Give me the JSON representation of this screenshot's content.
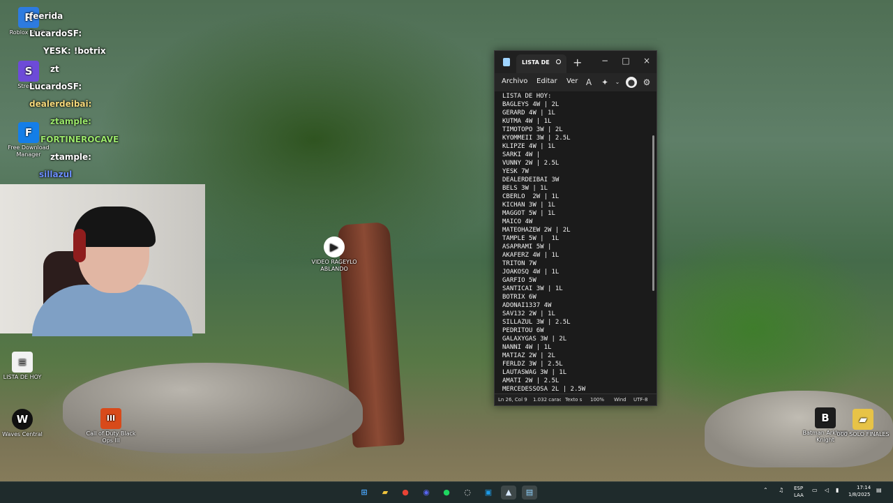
{
  "desktop": {
    "icons": [
      {
        "label": "Roblox Studio",
        "glyph": "R",
        "color": "#2d7be0"
      },
      {
        "label": "Stremio",
        "glyph": "S",
        "color": "#6d4bd8"
      },
      {
        "label": "Free Download Manager",
        "glyph": "F",
        "color": "#147ee8"
      },
      {
        "label": "LISTA DE HOY",
        "glyph": "≡",
        "color": "#f2f2f2"
      },
      {
        "label": "Waves Central",
        "glyph": "W",
        "color": "#111111"
      },
      {
        "label": "Call of Duty Black Ops III",
        "glyph": "III",
        "color": "#d84a1a"
      },
      {
        "label": "Batman Arkham Knight",
        "glyph": "B",
        "color": "#1d1d1d"
      },
      {
        "label": "000 SOLO FINALES",
        "glyph": "▰",
        "color": "#e7c347"
      },
      {
        "label": "VIDEO RAGEYLO ABLANDO",
        "glyph": "▶",
        "color": "#ffffff"
      }
    ]
  },
  "chat": {
    "messages": [
      {
        "user": "feerida",
        "color": "#ffffff"
      },
      {
        "user": "LucardoSF:",
        "color": "#ffffff"
      },
      {
        "user": "YESK:",
        "text": "!botrix",
        "color": "#ffffff"
      },
      {
        "user": "zt",
        "color": "#ffffff"
      },
      {
        "user": "LucardoSF:",
        "color": "#ffffff"
      },
      {
        "user": "dealerdeibai:",
        "color": "#f5d97b"
      },
      {
        "user": "ztample:",
        "color": "#9be86b"
      },
      {
        "user": "FORTINEROCAVE",
        "color": "#9be86b"
      },
      {
        "user": "ztample:",
        "color": "#ffffff"
      },
      {
        "user": "sillazul",
        "color": "#6c8fff"
      }
    ]
  },
  "notepad": {
    "tab_title": "LISTA DE H",
    "new_tab": "+",
    "window_controls": [
      "−",
      "□",
      "×"
    ],
    "menu": {
      "file": "Archivo",
      "edit": "Editar",
      "view": "Ver"
    },
    "text_lines": [
      "LISTA DE HOY:",
      "BAGLEYS 4W | 2L",
      "GERARD 4W | 1L",
      "KUTMA 4W | 1L",
      "TIMOTOPO 3W | 2L",
      "KYOMMEII 3W | 2.5L",
      "KLIPZE 4W | 1L",
      "SARKI 4W |",
      "VUNNY 2W | 2.5L",
      "YESK 7W",
      "DEALERDEIBAI 3W",
      "BELS 3W | 1L",
      "CBERLO  2W | 1L",
      "KICHAN 3W | 1L",
      "MAGGOT 5W | 1L",
      "MAICO 4W",
      "MATEOHAZEW 2W | 2L",
      "TAMPLE 5W |  1L",
      "ASAPRAMI 5W |",
      "AKAFERZ 4W | 1L",
      "TRITON 7W",
      "JOAKOSQ 4W | 1L",
      "GARFIO 5W",
      "SANTICAI 3W | 1L",
      "BOTRIX 6W",
      "ADONAI1337 4W",
      "SAV132 2W | 1L",
      "SILLAZUL 3W | 2.5L",
      "PEDRITOU 6W",
      "GALAXYGAS 3W | 2L",
      "NANNI 4W | 1L",
      "MATIAZ 2W | 2L",
      "FERLDZ 3W | 2.5L",
      "LAUTASWAG 3W | 1L",
      "AMATI 2W | 2.5L",
      "MERCEDESSOSA 2L | 2.5W"
    ],
    "status": {
      "position": "Ln 26, Col 9",
      "chars": "1.032 caract",
      "format": "Texto s",
      "zoom": "100%",
      "line_endings": "Wind",
      "encoding": "UTF-8"
    }
  },
  "taskbar": {
    "apps": [
      {
        "name": "windows",
        "glyph": "⊞",
        "color": "#4aa8ff"
      },
      {
        "name": "files",
        "glyph": "▰",
        "color": "#f0c43c"
      },
      {
        "name": "chrome",
        "glyph": "●",
        "color": "#e94335"
      },
      {
        "name": "discord",
        "glyph": "◉",
        "color": "#5865f2"
      },
      {
        "name": "spotify",
        "glyph": "●",
        "color": "#1ed760"
      },
      {
        "name": "obs",
        "glyph": "◌",
        "color": "#ffffff"
      },
      {
        "name": "remote",
        "glyph": "▣",
        "color": "#1c9be8"
      },
      {
        "name": "steam",
        "glyph": "▲",
        "color": "#d7e8ff"
      },
      {
        "name": "notepad",
        "glyph": "▤",
        "color": "#8fd2ff"
      }
    ],
    "tray": {
      "language_top": "ESP",
      "language_bottom": "LAA",
      "time": "17:14",
      "date": "1/8/2025"
    }
  }
}
